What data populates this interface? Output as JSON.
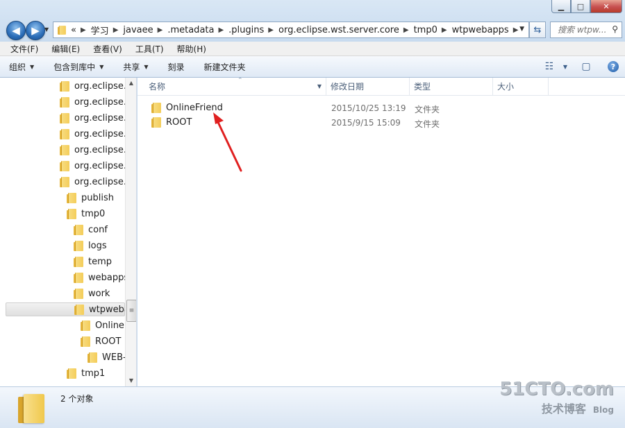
{
  "window": {
    "controls": {
      "minimize": "▁",
      "maximize": "□",
      "close": "✕"
    }
  },
  "address": {
    "overflow": "«",
    "crumbs": [
      "学习",
      "javaee",
      ".metadata",
      ".plugins",
      "org.eclipse.wst.server.core",
      "tmp0",
      "wtpwebapps"
    ],
    "search_placeholder": "搜索 wtpw..."
  },
  "menu": [
    "文件(F)",
    "编辑(E)",
    "查看(V)",
    "工具(T)",
    "帮助(H)"
  ],
  "toolbar": {
    "organize": "组织",
    "include_library": "包含到库中",
    "share": "共享",
    "burn": "刻录",
    "new_folder": "新建文件夹"
  },
  "tree": [
    {
      "label": "org.eclipse.v",
      "indent": 0
    },
    {
      "label": "org.eclipse.v",
      "indent": 0
    },
    {
      "label": "org.eclipse.v",
      "indent": 0
    },
    {
      "label": "org.eclipse.v",
      "indent": 0
    },
    {
      "label": "org.eclipse.v",
      "indent": 0
    },
    {
      "label": "org.eclipse.v",
      "indent": 0
    },
    {
      "label": "org.eclipse.v",
      "indent": 0
    },
    {
      "label": "publish",
      "indent": 1
    },
    {
      "label": "tmp0",
      "indent": 1
    },
    {
      "label": "conf",
      "indent": 2
    },
    {
      "label": "logs",
      "indent": 2
    },
    {
      "label": "temp",
      "indent": 2
    },
    {
      "label": "webapps",
      "indent": 2
    },
    {
      "label": "work",
      "indent": 2
    },
    {
      "label": "wtpweba",
      "indent": 2,
      "selected": true
    },
    {
      "label": "OnlineF",
      "indent": 3
    },
    {
      "label": "ROOT",
      "indent": 3
    },
    {
      "label": "WEB-",
      "indent": 4
    },
    {
      "label": "tmp1",
      "indent": 1
    }
  ],
  "columns": {
    "name": "名称",
    "date": "修改日期",
    "type": "类型",
    "size": "大小"
  },
  "files": [
    {
      "name": "OnlineFriend",
      "date": "2015/10/25 13:19",
      "type": "文件夹"
    },
    {
      "name": "ROOT",
      "date": "2015/9/15 15:09",
      "type": "文件夹"
    }
  ],
  "details": {
    "count": "2 个对象"
  },
  "watermark": {
    "site": "51CTO.com",
    "sub": "技术博客",
    "blog": "Blog"
  }
}
